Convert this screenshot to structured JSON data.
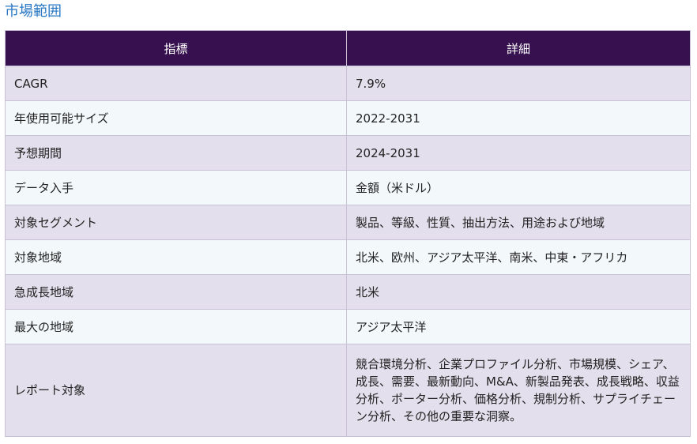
{
  "heading": "市場範囲",
  "table": {
    "headers": [
      "指標",
      "詳細"
    ],
    "rows": [
      {
        "metric": "CAGR",
        "detail": "7.9%"
      },
      {
        "metric": "年使用可能サイズ",
        "detail": "2022-2031"
      },
      {
        "metric": "予想期間",
        "detail": "2024-2031"
      },
      {
        "metric": "データ入手",
        "detail": "金額（米ドル）"
      },
      {
        "metric": "対象セグメント",
        "detail": "製品、等級、性質、抽出方法、用途および地域"
      },
      {
        "metric": "対象地域",
        "detail": "北米、欧州、アジア太平洋、南米、中東・アフリカ"
      },
      {
        "metric": "急成長地域",
        "detail": "北米"
      },
      {
        "metric": "最大の地域",
        "detail": "アジア太平洋"
      },
      {
        "metric": "レポート対象",
        "detail": "競合環境分析、企業プロファイル分析、市場規模、シェア、成長、需要、最新動向、M&A、新製品発表、成長戦略、収益分析、ポーター分析、価格分析、規制分析、サプライチェーン分析、その他の重要な洞察。"
      }
    ]
  }
}
